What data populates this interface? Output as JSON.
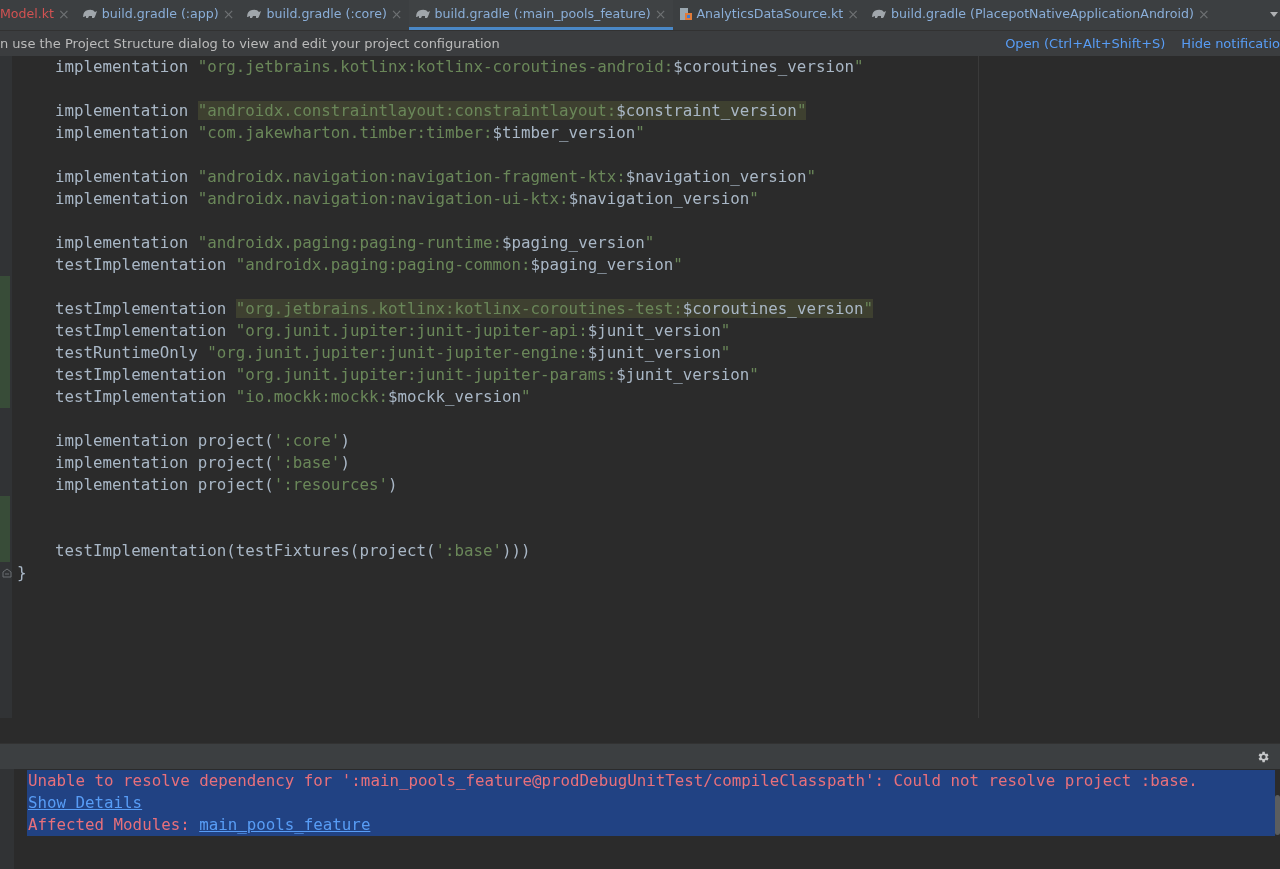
{
  "tabs": [
    {
      "label": "Model.kt",
      "close": "×",
      "kind": "plain",
      "error": true,
      "selected": false
    },
    {
      "label": "build.gradle (:app)",
      "close": "×",
      "kind": "gradle",
      "error": false,
      "selected": false
    },
    {
      "label": "build.gradle (:core)",
      "close": "×",
      "kind": "gradle",
      "error": false,
      "selected": false
    },
    {
      "label": "build.gradle (:main_pools_feature)",
      "close": "×",
      "kind": "gradle",
      "error": false,
      "selected": true
    },
    {
      "label": "AnalyticsDataSource.kt",
      "close": "×",
      "kind": "kotlin",
      "error": false,
      "selected": false
    },
    {
      "label": "build.gradle (PlacepotNativeApplicationAndroid)",
      "close": "×",
      "kind": "gradle",
      "error": false,
      "selected": false
    }
  ],
  "notification": {
    "text": "n use the Project Structure dialog to view and edit your project configuration",
    "links": [
      "Open (Ctrl+Alt+Shift+S)",
      "Hide notificatio"
    ]
  },
  "code_lines": [
    {
      "changed": false,
      "fold_marker": false,
      "parts": [
        {
          "text": "    implementation ",
          "kind": "plain"
        },
        {
          "text": "\"org.jetbrains.kotlinx:kotlinx-coroutines-android:",
          "kind": "string"
        },
        {
          "text": "$coroutines_version",
          "kind": "plain"
        },
        {
          "text": "\"",
          "kind": "string"
        }
      ]
    },
    {
      "changed": false,
      "fold_marker": false
    },
    {
      "changed": false,
      "fold_marker": false,
      "parts": [
        {
          "text": "    implementation ",
          "kind": "plain"
        },
        {
          "text": "\"androidx.constraintlayout:constraintlayout:",
          "kind": "match-string"
        },
        {
          "text": "$constraint_version",
          "kind": "match-plain"
        },
        {
          "text": "\"",
          "kind": "match-string"
        }
      ]
    },
    {
      "changed": false,
      "fold_marker": false,
      "parts": [
        {
          "text": "    implementation ",
          "kind": "plain"
        },
        {
          "text": "\"com.jakewharton.timber:timber:",
          "kind": "string"
        },
        {
          "text": "$timber_version",
          "kind": "plain"
        },
        {
          "text": "\"",
          "kind": "string"
        }
      ]
    },
    {
      "changed": false,
      "fold_marker": false
    },
    {
      "changed": false,
      "fold_marker": false,
      "parts": [
        {
          "text": "    implementation ",
          "kind": "plain"
        },
        {
          "text": "\"androidx.navigation:navigation-fragment-ktx:",
          "kind": "string"
        },
        {
          "text": "$navigation_version",
          "kind": "plain"
        },
        {
          "text": "\"",
          "kind": "string"
        }
      ]
    },
    {
      "changed": false,
      "fold_marker": false,
      "parts": [
        {
          "text": "    implementation ",
          "kind": "plain"
        },
        {
          "text": "\"androidx.navigation:navigation-ui-ktx:",
          "kind": "string"
        },
        {
          "text": "$navigation_version",
          "kind": "plain"
        },
        {
          "text": "\"",
          "kind": "string"
        }
      ]
    },
    {
      "changed": false,
      "fold_marker": false
    },
    {
      "changed": false,
      "fold_marker": false,
      "parts": [
        {
          "text": "    implementation ",
          "kind": "plain"
        },
        {
          "text": "\"androidx.paging:paging-runtime:",
          "kind": "string"
        },
        {
          "text": "$paging_version",
          "kind": "plain"
        },
        {
          "text": "\"",
          "kind": "string"
        }
      ]
    },
    {
      "changed": false,
      "fold_marker": false,
      "parts": [
        {
          "text": "    testImplementation ",
          "kind": "plain"
        },
        {
          "text": "\"androidx.paging:paging-common:",
          "kind": "string"
        },
        {
          "text": "$paging_version",
          "kind": "plain"
        },
        {
          "text": "\"",
          "kind": "string"
        }
      ]
    },
    {
      "changed": true,
      "fold_marker": false
    },
    {
      "changed": true,
      "fold_marker": false,
      "parts": [
        {
          "text": "    testImplementation ",
          "kind": "plain"
        },
        {
          "text": "\"org.jetbrains.kotlinx:kotlinx-coroutines-test:",
          "kind": "match-string"
        },
        {
          "text": "$coroutines_version",
          "kind": "match-plain"
        },
        {
          "text": "\"",
          "kind": "match-string"
        }
      ]
    },
    {
      "changed": true,
      "fold_marker": false,
      "parts": [
        {
          "text": "    testImplementation ",
          "kind": "plain"
        },
        {
          "text": "\"org.junit.jupiter:junit-jupiter-api:",
          "kind": "string"
        },
        {
          "text": "$junit_version",
          "kind": "plain"
        },
        {
          "text": "\"",
          "kind": "string"
        }
      ]
    },
    {
      "changed": true,
      "fold_marker": false,
      "parts": [
        {
          "text": "    testRuntimeOnly ",
          "kind": "plain"
        },
        {
          "text": "\"org.junit.jupiter:junit-jupiter-engine:",
          "kind": "string"
        },
        {
          "text": "$junit_version",
          "kind": "plain"
        },
        {
          "text": "\"",
          "kind": "string"
        }
      ]
    },
    {
      "changed": true,
      "fold_marker": false,
      "parts": [
        {
          "text": "    testImplementation ",
          "kind": "plain"
        },
        {
          "text": "\"org.junit.jupiter:junit-jupiter-params:",
          "kind": "string"
        },
        {
          "text": "$junit_version",
          "kind": "plain"
        },
        {
          "text": "\"",
          "kind": "string"
        }
      ]
    },
    {
      "changed": true,
      "fold_marker": false,
      "parts": [
        {
          "text": "    testImplementation ",
          "kind": "plain"
        },
        {
          "text": "\"io.mockk:mockk:",
          "kind": "string"
        },
        {
          "text": "$mockk_version",
          "kind": "plain"
        },
        {
          "text": "\"",
          "kind": "string"
        }
      ]
    },
    {
      "changed": false,
      "fold_marker": false
    },
    {
      "changed": false,
      "fold_marker": false,
      "parts": [
        {
          "text": "    implementation project(",
          "kind": "plain"
        },
        {
          "text": "':core'",
          "kind": "string"
        },
        {
          "text": ")",
          "kind": "plain"
        }
      ]
    },
    {
      "changed": false,
      "fold_marker": false,
      "parts": [
        {
          "text": "    implementation project(",
          "kind": "plain"
        },
        {
          "text": "':base'",
          "kind": "string"
        },
        {
          "text": ")",
          "kind": "plain"
        }
      ]
    },
    {
      "changed": false,
      "fold_marker": false,
      "parts": [
        {
          "text": "    implementation project(",
          "kind": "plain"
        },
        {
          "text": "':resources'",
          "kind": "string"
        },
        {
          "text": ")",
          "kind": "plain"
        }
      ]
    },
    {
      "changed": true,
      "fold_marker": false
    },
    {
      "changed": true,
      "fold_marker": false
    },
    {
      "changed": true,
      "fold_marker": false,
      "parts": [
        {
          "text": "    testImplementation(testFixtures(project(",
          "kind": "plain"
        },
        {
          "text": "':base'",
          "kind": "string"
        },
        {
          "text": ")))",
          "kind": "plain"
        }
      ]
    },
    {
      "changed": false,
      "fold_marker": true,
      "parts": [
        {
          "text": "}",
          "kind": "plain"
        }
      ]
    }
  ],
  "message": {
    "error_text": "Unable to resolve dependency for ':main_pools_feature@prodDebugUnitTest/compileClasspath': Could not resolve project :base.",
    "details_link": "Show Details",
    "affected_label": "Affected Modules: ",
    "affected_link": "main_pools_feature"
  }
}
